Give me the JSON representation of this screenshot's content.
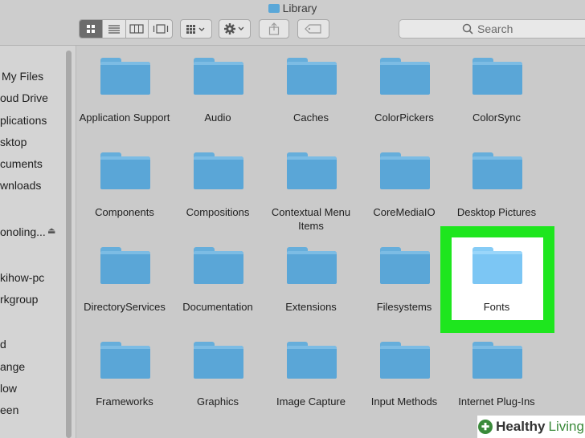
{
  "window": {
    "title": "Library"
  },
  "toolbar": {
    "view_buttons": [
      "icon-view-icon",
      "list-view-icon",
      "column-view-icon",
      "gallery-view-icon"
    ],
    "group_icon": "group-grid-icon",
    "action_icon": "gear-icon",
    "search": {
      "placeholder": "Search"
    }
  },
  "sidebar": {
    "items": [
      "My Files",
      "oud Drive",
      "plications",
      "sktop",
      "cuments",
      "wnloads",
      "onoling...",
      "kihow-pc",
      "rkgroup",
      "d",
      "ange",
      "low",
      "een"
    ]
  },
  "folders": [
    "Application Support",
    "Audio",
    "Caches",
    "ColorPickers",
    "ColorSync",
    "Components",
    "Compositions",
    "Contextual Menu Items",
    "CoreMediaIO",
    "Desktop Pictures",
    "DirectoryServices",
    "Documentation",
    "Extensions",
    "Filesystems",
    "Fonts",
    "Frameworks",
    "Graphics",
    "Image Capture",
    "Input Methods",
    "Internet Plug-Ins"
  ],
  "selected_folder": "Fonts",
  "watermark": {
    "brand": "Healthy",
    "suffix": "Living"
  },
  "colors": {
    "highlight": "#1ee61e",
    "folder": "#5aa6d7",
    "background": "#cacaca"
  }
}
